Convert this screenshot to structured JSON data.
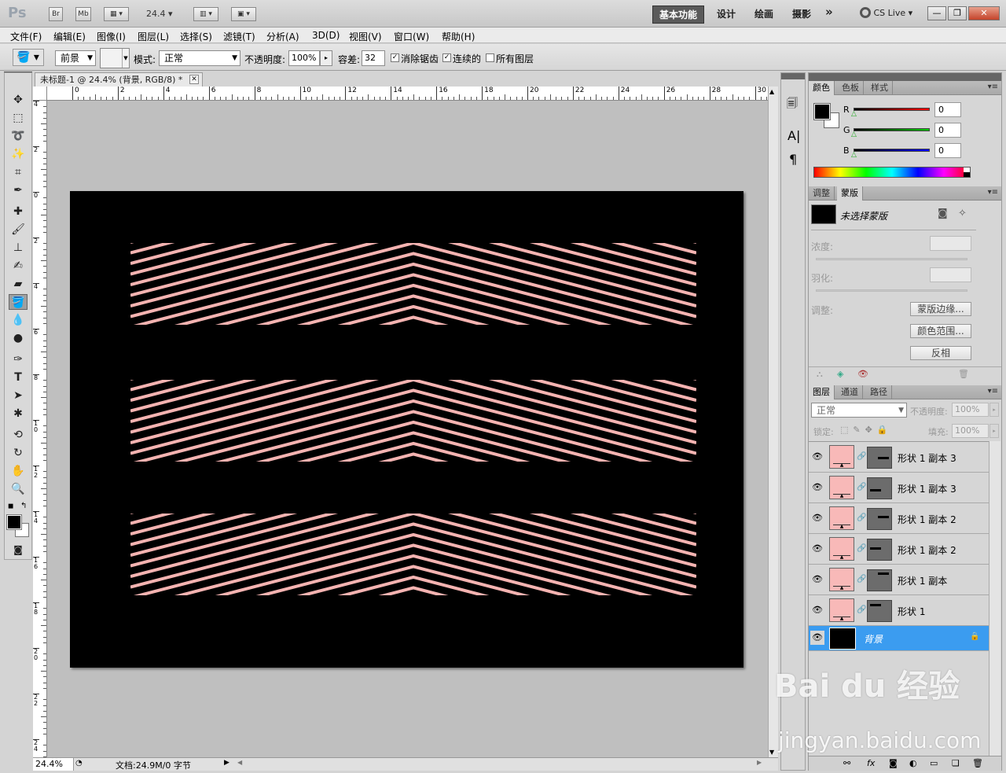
{
  "app": {
    "logo": "Ps",
    "bridge": "Br",
    "mini": "Mb",
    "zoom_select": "24.4",
    "cs_live": "CS Live"
  },
  "workspaces": [
    {
      "label": "基本功能",
      "active": true
    },
    {
      "label": "设计"
    },
    {
      "label": "绘画"
    },
    {
      "label": "摄影"
    },
    {
      "label": "»"
    }
  ],
  "menu": [
    "文件(F)",
    "编辑(E)",
    "图像(I)",
    "图层(L)",
    "选择(S)",
    "滤镜(T)",
    "分析(A)",
    "3D(D)",
    "视图(V)",
    "窗口(W)",
    "帮助(H)"
  ],
  "options": {
    "fill_source": "前景",
    "mode_label": "模式:",
    "mode_value": "正常",
    "opacity_label": "不透明度:",
    "opacity_value": "100%",
    "tolerance_label": "容差:",
    "tolerance_value": "32",
    "antialias_label": "消除锯齿",
    "contiguous_label": "连续的",
    "all_layers_label": "所有图层",
    "antialias_checked": true,
    "contiguous_checked": true,
    "all_layers_checked": false
  },
  "document": {
    "tab_title": "未标题-1 @ 24.4% (背景, RGB/8) *",
    "zoom": "24.4%",
    "doc_info": "文档:24.9M/0 字节",
    "h_ticks": [
      "0",
      "2",
      "4",
      "6",
      "8",
      "10",
      "12",
      "14",
      "16",
      "18",
      "20",
      "22",
      "24",
      "26",
      "28",
      "30"
    ],
    "v_ticks": [
      "4",
      "2",
      "0",
      "2",
      "4",
      "6",
      "8",
      "10",
      "12",
      "14",
      "16",
      "18",
      "20",
      "22",
      "24"
    ],
    "canvas_bg": "#000000",
    "stripe_color": "#f4b3b1"
  },
  "color_panel": {
    "tabs": [
      "颜色",
      "色板",
      "样式"
    ],
    "r_label": "R",
    "g_label": "G",
    "b_label": "B",
    "r_value": "0",
    "g_value": "0",
    "b_value": "0"
  },
  "masks_panel": {
    "tabs": [
      "调整",
      "蒙版"
    ],
    "no_mask": "未选择蒙版",
    "density_label": "浓度:",
    "feather_label": "羽化:",
    "refine_label": "调整:",
    "mask_edge_button": "蒙版边缘...",
    "color_range_button": "颜色范围...",
    "invert_button": "反相"
  },
  "layers_panel": {
    "tabs": [
      "图层",
      "通道",
      "路径"
    ],
    "blend_mode": "正常",
    "opacity_label": "不透明度:",
    "opacity_value": "100%",
    "lock_label": "锁定:",
    "fill_label": "填充:",
    "fill_value": "100%",
    "layers": [
      {
        "name": "形状 1 副本 3",
        "selected": false
      },
      {
        "name": "形状 1 副本 3",
        "selected": false
      },
      {
        "name": "形状 1 副本 2",
        "selected": false
      },
      {
        "name": "形状 1 副本 2",
        "selected": false
      },
      {
        "name": "形状 1 副本",
        "selected": false
      },
      {
        "name": "形状 1",
        "selected": false
      },
      {
        "name": "背景",
        "selected": true
      }
    ],
    "footer_icons": [
      "link-icon",
      "fx-icon",
      "mask-icon",
      "adjustment-icon",
      "group-icon",
      "new-layer-icon",
      "trash-icon"
    ]
  },
  "watermark": {
    "line1": "Bai du 经验",
    "line2": "jingyan.baidu.com"
  }
}
